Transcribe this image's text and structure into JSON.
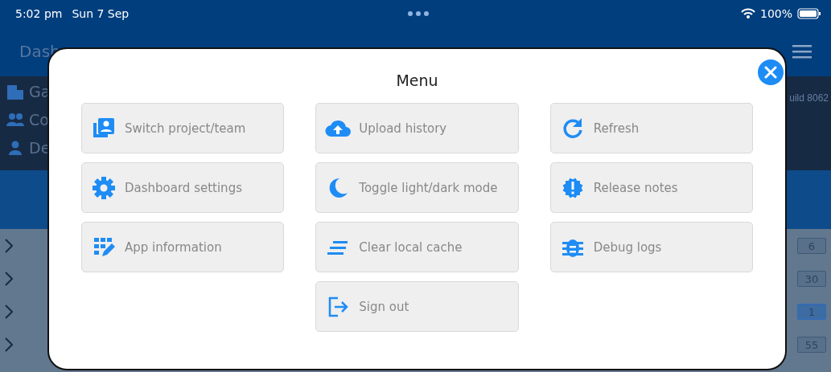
{
  "status_bar": {
    "time": "5:02 pm",
    "date": "Sun 7 Sep",
    "battery": "100%"
  },
  "header": {
    "title": "Dash"
  },
  "sidebar": {
    "items": [
      {
        "label": "Ga"
      },
      {
        "label": "Co"
      },
      {
        "label": "De"
      }
    ],
    "build": "uild 8062"
  },
  "list": {
    "rows": [
      {
        "count": "6",
        "highlighted": false
      },
      {
        "count": "30",
        "highlighted": false
      },
      {
        "count": "1",
        "highlighted": true
      },
      {
        "count": "55",
        "highlighted": false
      }
    ]
  },
  "menu": {
    "title": "Menu",
    "columns": [
      [
        {
          "label": "Switch project/team"
        },
        {
          "label": "Dashboard settings"
        },
        {
          "label": "App information"
        }
      ],
      [
        {
          "label": "Upload history"
        },
        {
          "label": "Toggle light/dark mode"
        },
        {
          "label": "Clear local cache"
        },
        {
          "label": "Sign out"
        }
      ],
      [
        {
          "label": "Refresh"
        },
        {
          "label": "Release notes"
        },
        {
          "label": "Debug logs"
        }
      ]
    ]
  }
}
